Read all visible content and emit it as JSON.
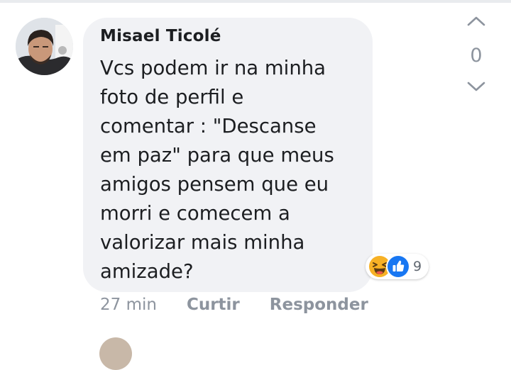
{
  "comment": {
    "author": "Misael Ticolé",
    "lines": [
      "Vcs podem ir na minha",
      "foto de perfil e",
      "comentar : \"Descanse",
      "em paz\" para que meus",
      "amigos pensem que eu",
      "morri e comecem a",
      "valorizar mais minha",
      "amizade?"
    ],
    "time": "27 min",
    "actions": {
      "like": "Curtir",
      "reply": "Responder"
    },
    "reactions": {
      "icons": [
        "laugh-icon",
        "thumbs-up-icon"
      ],
      "count": "9"
    }
  },
  "vote": {
    "count": "0"
  },
  "colors": {
    "bubble": "#f1f2f5",
    "text": "#1c1e21",
    "meta": "#8d949e",
    "like_blue": "#1877f2",
    "haha_yellow": "#f7b125"
  }
}
